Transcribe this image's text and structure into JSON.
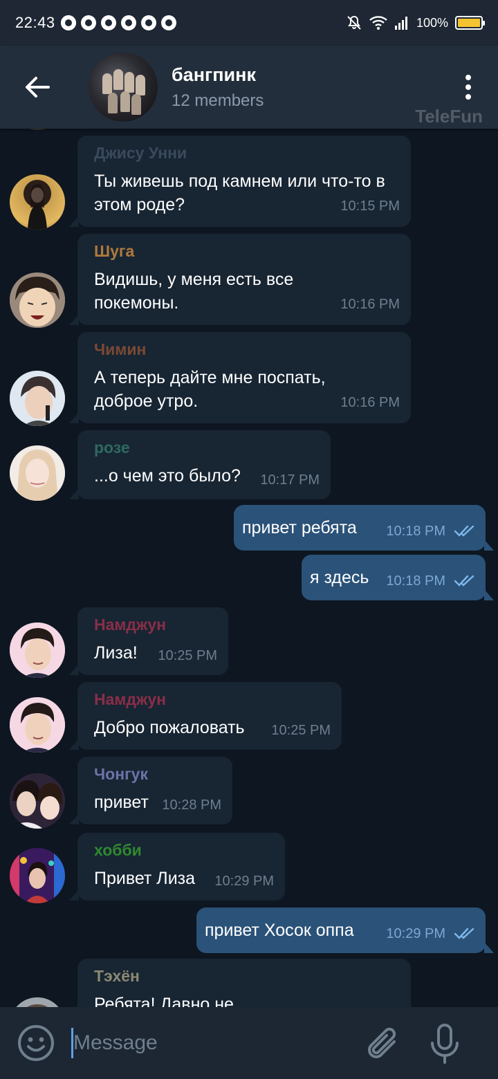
{
  "status_bar": {
    "time": "22:43",
    "battery_percent": "100%",
    "battery_level": 1.0
  },
  "header": {
    "title": "бангпинк",
    "subtitle": "12 members",
    "watermark": "TeleFun"
  },
  "messages": [
    {
      "direction": "in",
      "sender": "Джису Унни",
      "sender_color": "#3a4a5c",
      "text": "Ты живешь под камнем или что-то в этом роде?",
      "time": "10:15 PM",
      "avatar": "avatar-jisoo"
    },
    {
      "direction": "in",
      "sender": "Шуга",
      "sender_color": "#b07a3c",
      "text": "Видишь, у меня есть все покемоны.",
      "time": "10:16 PM",
      "avatar": "avatar-suga"
    },
    {
      "direction": "in",
      "sender": "Чимин",
      "sender_color": "#7a4a32",
      "text": "А теперь дайте мне поспать, доброе утро.",
      "time": "10:16 PM",
      "avatar": "avatar-jimin"
    },
    {
      "direction": "in",
      "sender": "розе",
      "sender_color": "#2e6a60",
      "text": "...о чем это было?",
      "time": "10:17 PM",
      "avatar": "avatar-rose"
    },
    {
      "direction": "out",
      "text": "привет ребята",
      "time": "10:18 PM",
      "read": true
    },
    {
      "direction": "out",
      "text": "я здесь",
      "time": "10:18 PM",
      "read": true
    },
    {
      "direction": "in",
      "sender": "Намджун",
      "sender_color": "#8a2e48",
      "text": "Лиза!",
      "time": "10:25 PM",
      "avatar": "avatar-namjoon"
    },
    {
      "direction": "in",
      "sender": "Намджун",
      "sender_color": "#8a2e48",
      "text": "Добро пожаловать",
      "time": "10:25 PM",
      "avatar": "avatar-namjoon"
    },
    {
      "direction": "in",
      "sender": "Чонгук",
      "sender_color": "#6e73a8",
      "text": "привет",
      "time": "10:28 PM",
      "avatar": "avatar-jungkook"
    },
    {
      "direction": "in",
      "sender": "хобби",
      "sender_color": "#2e8a2e",
      "text": "Привет Лиза",
      "time": "10:29 PM",
      "avatar": "avatar-hobi"
    },
    {
      "direction": "out",
      "text": "привет Хосок оппа",
      "time": "10:29 PM",
      "read": true
    },
    {
      "direction": "in",
      "sender": "Тэхён",
      "sender_color": "#8a8a72",
      "text": "Ребята! Давно не",
      "time": "",
      "avatar": "avatar-taehyung"
    }
  ],
  "input": {
    "placeholder": "Message"
  },
  "colors": {
    "chat_background": "#0e1621",
    "header_background": "#232e3c",
    "incoming_bubble": "#182533",
    "outgoing_bubble": "#2b5278",
    "accent": "#5ea2e6"
  },
  "icons": {
    "back": "arrow-left-icon",
    "menu": "more-vertical-icon",
    "emoji": "smiley-icon",
    "attach": "paperclip-icon",
    "mic": "microphone-icon",
    "read_receipt": "double-check-icon"
  }
}
